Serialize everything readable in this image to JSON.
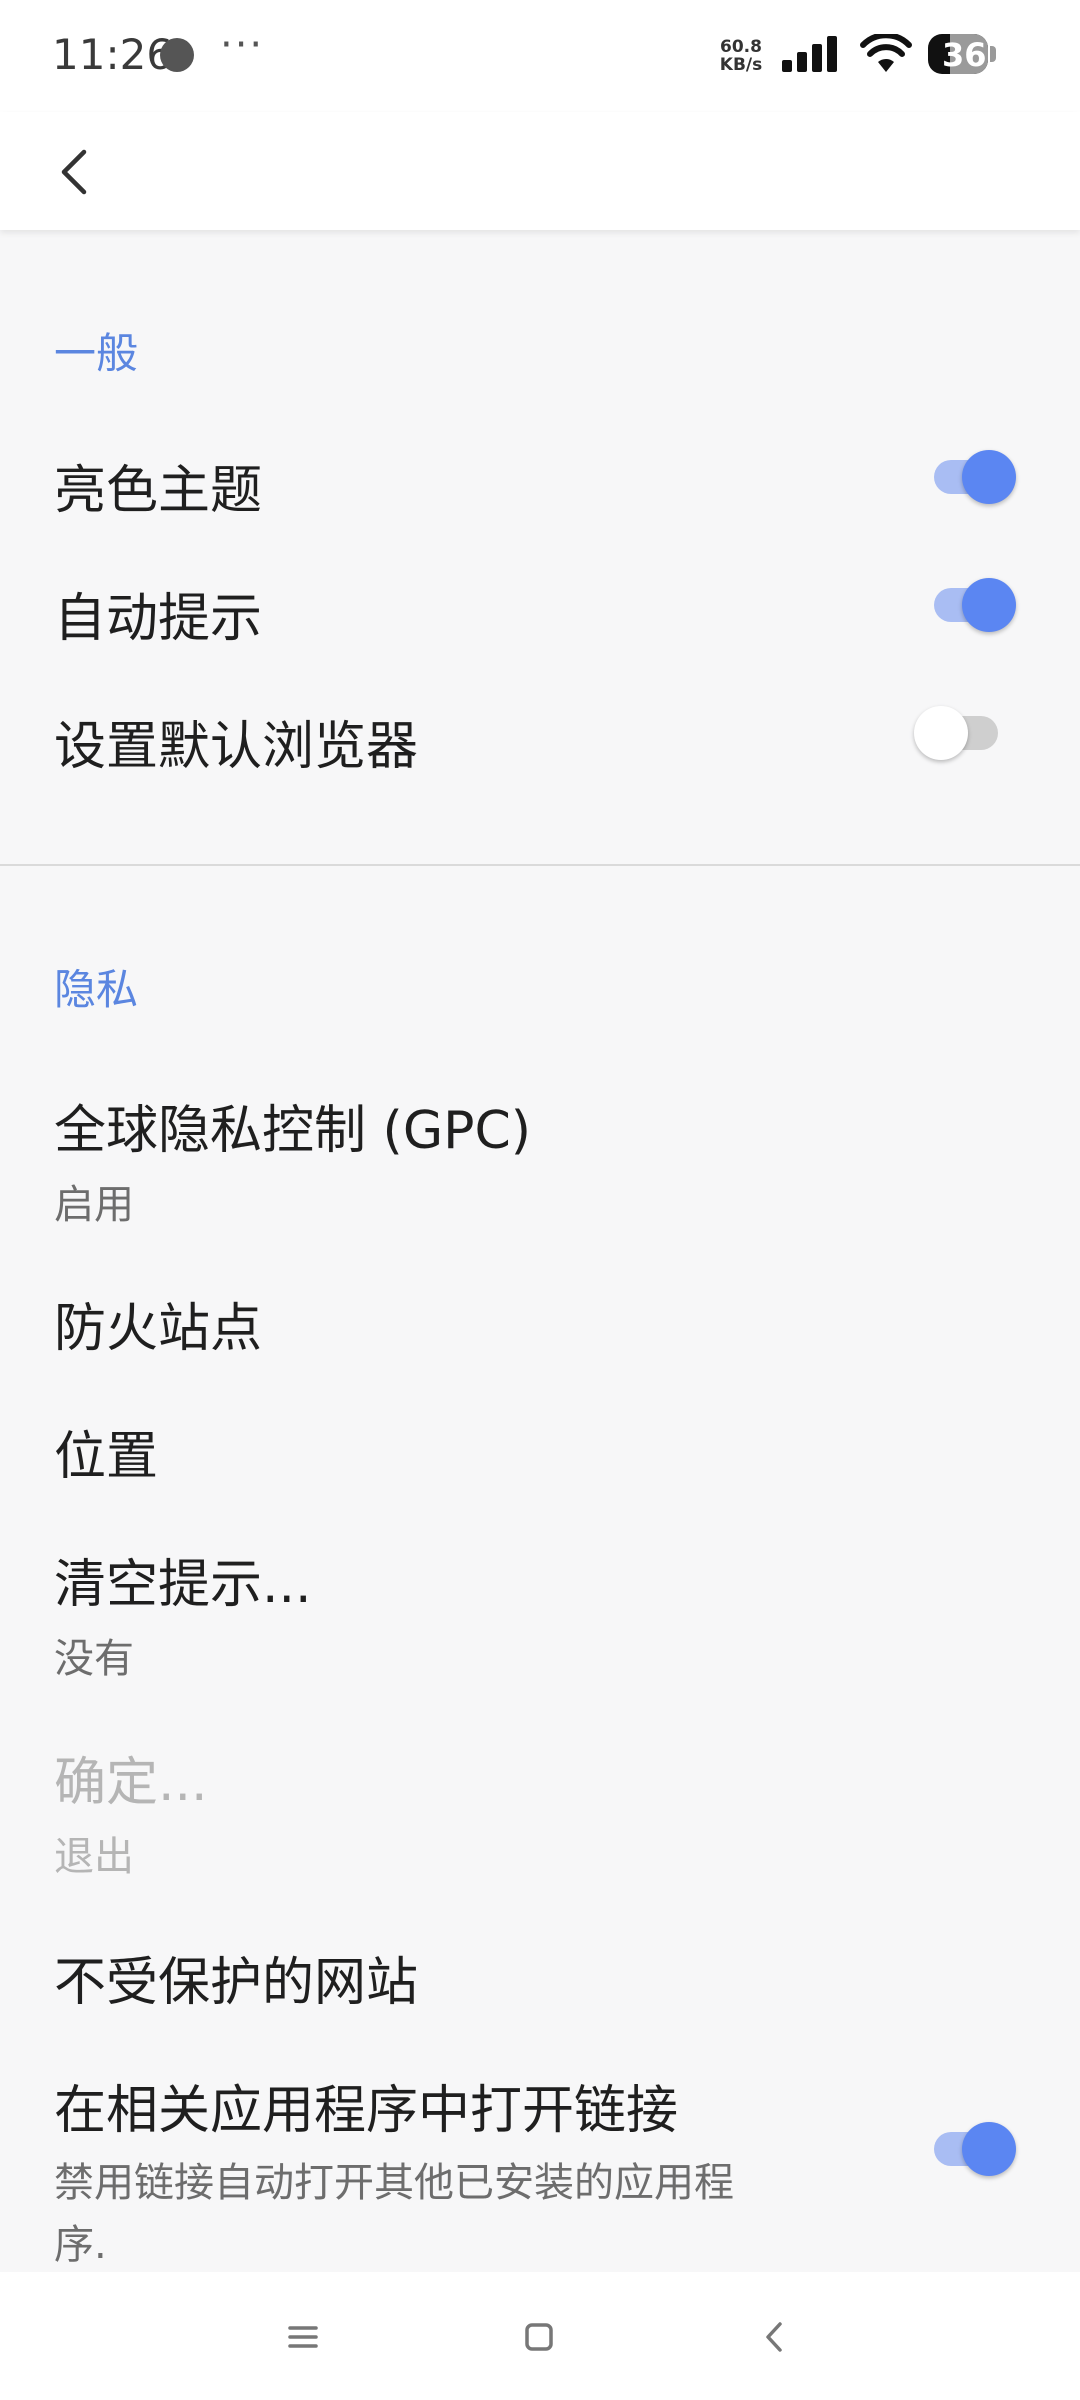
{
  "status_bar": {
    "time": "11:26",
    "more": "···",
    "speed_value": "60.8",
    "speed_unit": "KB/s",
    "battery": "36"
  },
  "app_bar": {
    "back_icon": "chevron-left-icon"
  },
  "general": {
    "title": "一般",
    "items": [
      {
        "label": "亮色主题",
        "toggle": true
      },
      {
        "label": "自动提示",
        "toggle": true
      },
      {
        "label": "设置默认浏览器",
        "toggle": false
      }
    ]
  },
  "privacy": {
    "title": "隐私",
    "gpc": {
      "label": "全球隐私控制 (GPC)",
      "sub": "启用"
    },
    "fireproof": {
      "label": "防火站点"
    },
    "location": {
      "label": "位置"
    },
    "clear": {
      "label": "清空提示...",
      "sub": "没有"
    },
    "confirm": {
      "label": "确定...",
      "sub": "退出",
      "disabled": true
    },
    "unprotected": {
      "label": "不受保护的网站"
    },
    "open_links": {
      "label": "在相关应用程序中打开链接",
      "sub_line1": "禁用链接自动打开其他已安装的应用程",
      "sub_line2": "序.",
      "toggle": true
    }
  },
  "nav_bar": {
    "menu_icon": "menu-icon",
    "home_icon": "home-icon",
    "back_icon": "back-icon"
  },
  "colors": {
    "accent": "#5b86f2",
    "section": "#5b86e0",
    "background": "#f7f7f8"
  }
}
